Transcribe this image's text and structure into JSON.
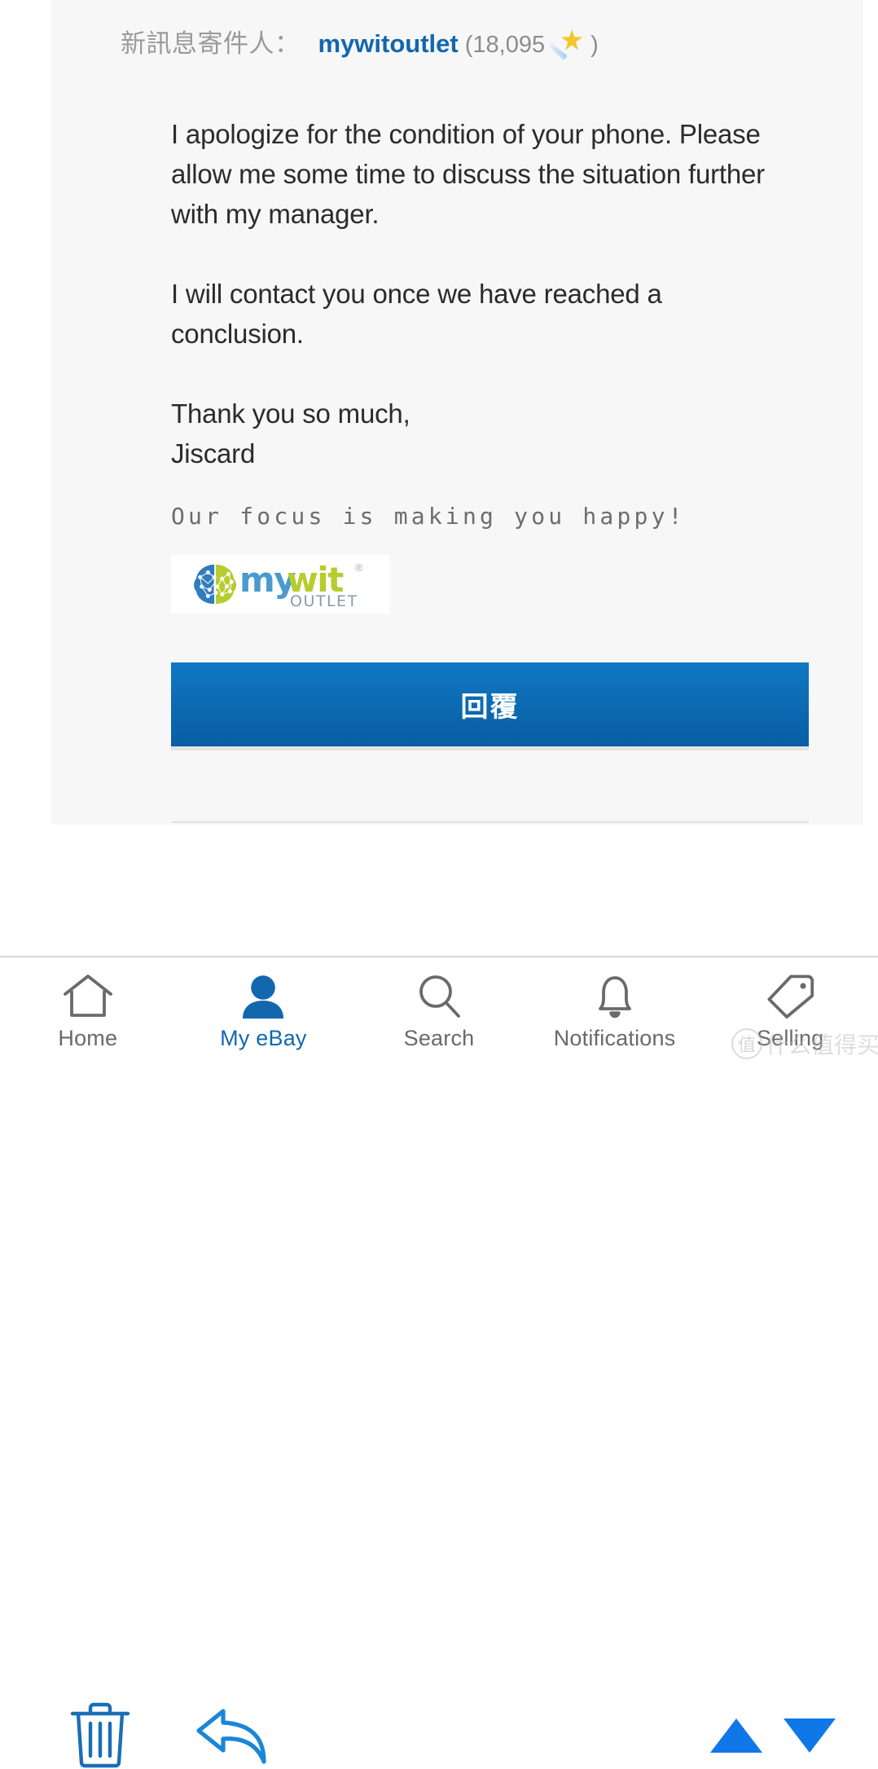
{
  "message": {
    "sender_prefix": "新訊息寄件人：",
    "sender_name": "mywitoutlet",
    "feedback_score": "(18,095",
    "feedback_score_close": ")",
    "star_icon": "shooting-star-icon",
    "paragraphs": [
      "I apologize for the condition of your phone. Please allow me some time to discuss the situation further with my manager.",
      "I will contact you once we have reached a conclusion."
    ],
    "signoff_line1": "Thank you so much,",
    "signoff_line2": "Jiscard",
    "tagline": "Our focus is making you happy!",
    "logo": {
      "word_part1": "my",
      "word_part2": "wit",
      "registered": "®",
      "subtitle": "OUTLET"
    },
    "reply_button_label": "回覆"
  },
  "action_bar": {
    "delete_icon": "trash-icon",
    "reply_icon": "reply-arrow-icon",
    "previous_icon": "triangle-up-icon",
    "next_icon": "triangle-down-icon"
  },
  "bottom_nav": {
    "items": [
      {
        "label": "Home",
        "icon": "home-icon",
        "active": false
      },
      {
        "label": "My eBay",
        "icon": "person-icon",
        "active": true
      },
      {
        "label": "Search",
        "icon": "magnifier-icon",
        "active": false
      },
      {
        "label": "Notifications",
        "icon": "bell-icon",
        "active": false
      },
      {
        "label": "Selling",
        "icon": "price-tag-icon",
        "active": false
      }
    ]
  },
  "watermark": {
    "mark": "值",
    "text": "什么值得买"
  },
  "colors": {
    "link_blue": "#1267ad",
    "button_blue": "#0c6cb4",
    "accent_blue": "#1077e8",
    "panel_gray": "#f7f7f7",
    "text_dark": "#2b2b2b",
    "nav_gray": "#6a6a6a"
  }
}
